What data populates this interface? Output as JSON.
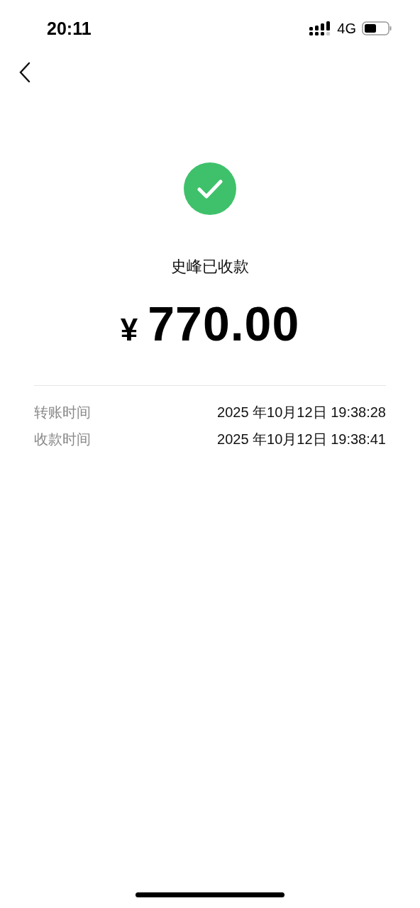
{
  "status_bar": {
    "time": "20:11",
    "network": "4G"
  },
  "receipt": {
    "received": true,
    "title": "史峰已收款",
    "currency": "¥",
    "amount": "770.00",
    "details": [
      {
        "label": "转账时间",
        "value": "2025 年10月12日 19:38:28"
      },
      {
        "label": "收款时间",
        "value": "2025 年10月12日 19:38:41"
      }
    ]
  }
}
